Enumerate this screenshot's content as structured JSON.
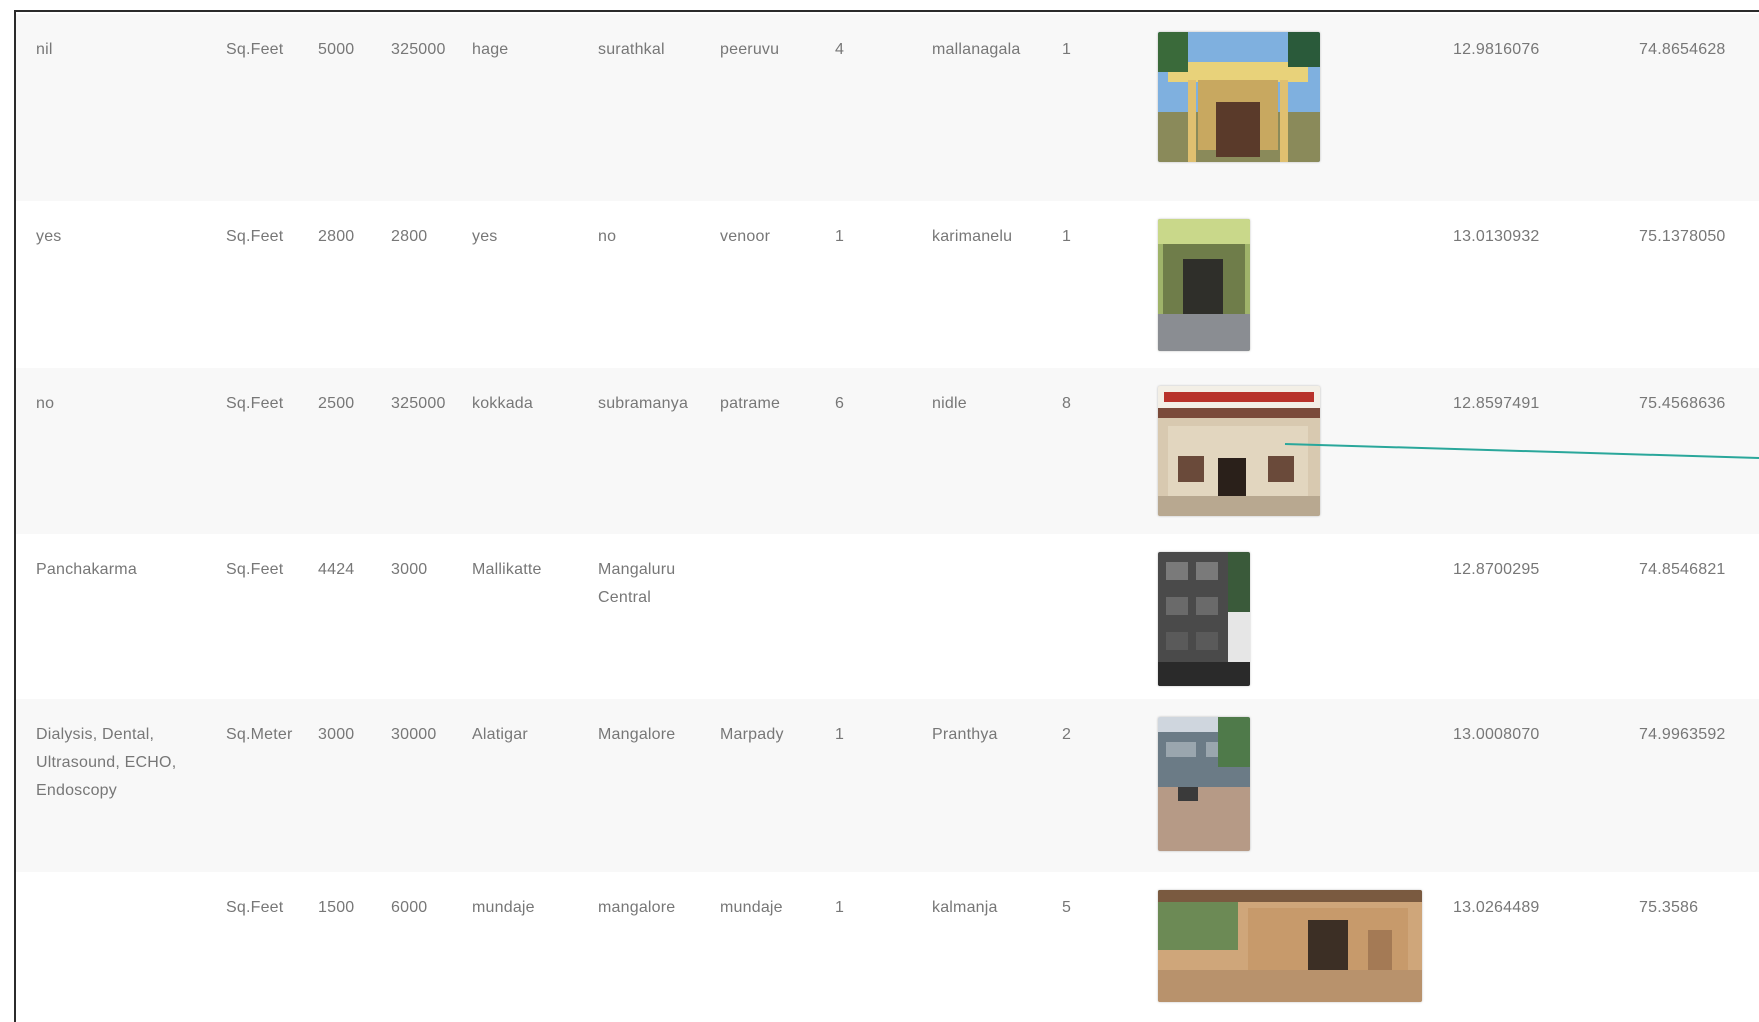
{
  "table": {
    "rows": [
      {
        "services": "nil",
        "unit": "Sq.Feet",
        "area": "5000",
        "amount": "325000",
        "place": "hage",
        "town": "surathkal",
        "locality": "peeruvu",
        "count1": "4",
        "village": "mallanagala",
        "count2": "1",
        "latitude": "12.9816076",
        "longitude": "74.8654628",
        "photo_icon": "building-photo-icon"
      },
      {
        "services": "yes",
        "unit": "Sq.Feet",
        "area": "2800",
        "amount": "2800",
        "place": "yes",
        "town": "no",
        "locality": "venoor",
        "count1": "1",
        "village": "karimanelu",
        "count2": "1",
        "latitude": "13.0130932",
        "longitude": "75.1378050",
        "photo_icon": "building-photo-icon"
      },
      {
        "services": "no",
        "unit": "Sq.Feet",
        "area": "2500",
        "amount": "325000",
        "place": "kokkada",
        "town": "subramanya",
        "locality": "patrame",
        "count1": "6",
        "village": "nidle",
        "count2": "8",
        "latitude": "12.8597491",
        "longitude": "75.4568636",
        "photo_icon": "building-photo-icon"
      },
      {
        "services": "Panchakarma",
        "unit": "Sq.Feet",
        "area": "4424",
        "amount": "3000",
        "place": "Mallikatte",
        "town": "Mangaluru Central",
        "locality": "",
        "count1": "",
        "village": "",
        "count2": "",
        "latitude": "12.8700295",
        "longitude": "74.8546821",
        "photo_icon": "building-photo-icon"
      },
      {
        "services": "Dialysis, Dental, Ultrasound, ECHO, Endoscopy",
        "unit": "Sq.Meter",
        "area": "3000",
        "amount": "30000",
        "place": "Alatigar",
        "town": "Mangalore",
        "locality": "Marpady",
        "count1": "1",
        "village": "Pranthya",
        "count2": "2",
        "latitude": "13.0008070",
        "longitude": "74.9963592",
        "photo_icon": "building-photo-icon"
      },
      {
        "services": "",
        "unit": "Sq.Feet",
        "area": "1500",
        "amount": "6000",
        "place": "mundaje",
        "town": "mangalore",
        "locality": "mundaje",
        "count1": "1",
        "village": "kalmanja",
        "count2": "5",
        "latitude": "13.0264489",
        "longitude": "75.3586",
        "photo_icon": "building-photo-icon"
      }
    ]
  },
  "colors": {
    "row_bg": "#f8f8f8",
    "text": "#777777",
    "frame_border": "#2b2b2b",
    "annotation_line": "#2aa79b"
  }
}
